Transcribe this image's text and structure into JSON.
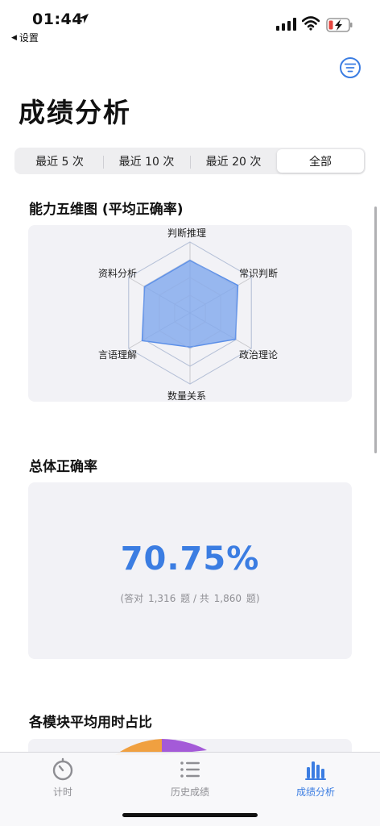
{
  "status_bar": {
    "time": "01:44",
    "back_label": "设置"
  },
  "header": {
    "title": "成绩分析",
    "filter_icon": "filter-lines-icon"
  },
  "segments": [
    {
      "label": "最近 5 次",
      "active": false
    },
    {
      "label": "最近 10 次",
      "active": false
    },
    {
      "label": "最近 20 次",
      "active": false
    },
    {
      "label": "全部",
      "active": true
    }
  ],
  "radar": {
    "title": "能力五维图 (平均正确率)",
    "axes": [
      "判断推理",
      "常识判断",
      "政治理论",
      "数量关系",
      "言语理解",
      "资料分析"
    ],
    "values": [
      0.74,
      0.78,
      0.74,
      0.48,
      0.78,
      0.74
    ],
    "fill_color": "#7fa8ee",
    "stroke_color": "#5b8fe8"
  },
  "overall": {
    "title": "总体正确率",
    "percent": "70.75%",
    "detail_prefix": "(答对",
    "correct": "1,316",
    "detail_mid": "题 / 共",
    "total": "1,860",
    "detail_suffix": "题)"
  },
  "module_time": {
    "title": "各模块平均用时占比",
    "colors": [
      "#f0a040",
      "#a45ad8"
    ]
  },
  "tabbar": {
    "items": [
      {
        "label": "计时",
        "icon": "timer-icon",
        "active": false
      },
      {
        "label": "历史成绩",
        "icon": "list-icon",
        "active": false
      },
      {
        "label": "成绩分析",
        "icon": "bar-chart-icon",
        "active": true
      }
    ]
  },
  "colors": {
    "accent": "#3b7de2",
    "card_bg": "#f2f2f6"
  }
}
